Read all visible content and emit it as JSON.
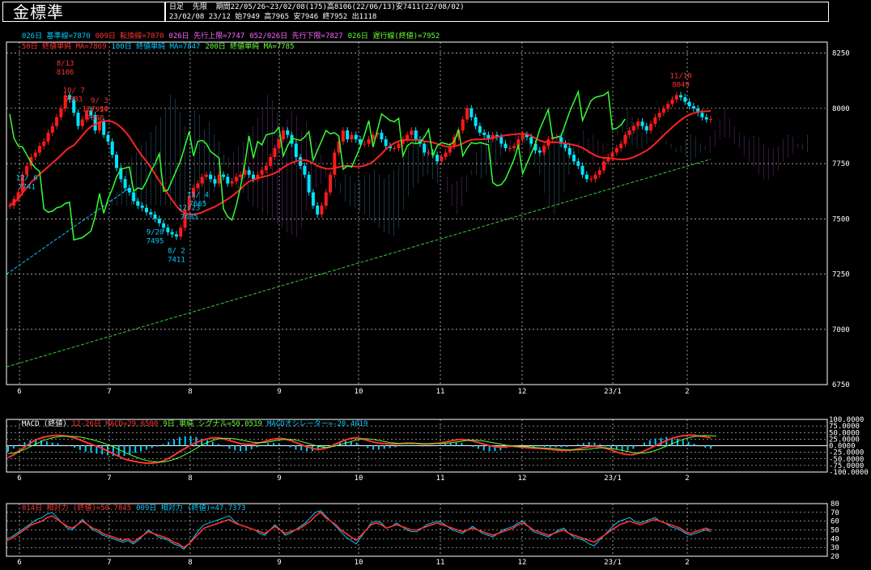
{
  "header": {
    "title": "金標準",
    "line1": "日足  先限  期間22/05/26~23/02/08(175)高8106(22/06/13)安7411(22/08/02)",
    "line2": "23/02/08 23/12 始7949 高7965 安7946 終7952 出1118"
  },
  "legend_main": [
    {
      "text": "026日 基準線=7870",
      "color": "#00ccff"
    },
    {
      "text": "009日 転換線=7870",
      "color": "#ff3333"
    },
    {
      "text": "026日 先行上限=7747",
      "color": "#ff66ff"
    },
    {
      "text": "052/026日 先行下限=7827",
      "color": "#ff66ff"
    },
    {
      "text": "026日 遅行線(終値)=7952",
      "color": "#66ff33"
    },
    {
      "text": "50日 終値単純 MA=7869",
      "color": "#ff3333"
    },
    {
      "text": "100日 終値単純 MA=7847",
      "color": "#00ccff"
    },
    {
      "text": "200日 終値単純 MA=7785",
      "color": "#66ff33"
    }
  ],
  "legend_macd": [
    {
      "text": "MACD (終値)",
      "color": "#ffffff"
    },
    {
      "text": "12-26日 MACD=29.6500",
      "color": "#ff3333"
    },
    {
      "text": "9日 単純 シグナル=50.0519",
      "color": "#66ff33"
    },
    {
      "text": "MACDオシレーター=-20.4019",
      "color": "#00ccff"
    }
  ],
  "legend_rsi": [
    {
      "text": "014日 相対力 (終値)=50.7845",
      "color": "#ff3333"
    },
    {
      "text": "009日 相対力 (終値)=47.7373",
      "color": "#00ccff"
    }
  ],
  "colors": {
    "up": "#ff1a1a",
    "down": "#00e5ff",
    "grid": "#ffffff",
    "kumo_up": "#66ccff",
    "kumo_down": "#cc66ff"
  },
  "x_month_labels": [
    "6",
    "7",
    "8",
    "9",
    "10",
    "11",
    "12",
    "23/1",
    "2"
  ],
  "chart_data": [
    {
      "type": "candlestick",
      "title": "金標準 日足",
      "ylim": [
        6750,
        8300
      ],
      "yticks": [
        6750,
        7000,
        7250,
        7500,
        7750,
        8000,
        8250
      ],
      "grid": true,
      "annotations": [
        {
          "date": "8/13",
          "value": 8106,
          "pos": "high"
        },
        {
          "date": "8/ 2",
          "value": 7411,
          "pos": "low"
        },
        {
          "date": "9/ 3",
          "value": 7937,
          "pos": "high"
        },
        {
          "date": "9/20",
          "value": 7495,
          "pos": "low"
        },
        {
          "date": "10/ 7",
          "value": 7983,
          "pos": "high"
        },
        {
          "date": "11/ 4",
          "value": 7665,
          "pos": "low"
        },
        {
          "date": "11/10",
          "value": 8049,
          "pos": "high"
        },
        {
          "date": "12/ 6",
          "value": 7741,
          "pos": "low"
        },
        {
          "date": "12/ 14",
          "value": 7898,
          "pos": "high"
        },
        {
          "date": "12/23",
          "value": 7605,
          "pos": "low"
        }
      ],
      "close_series": [
        7560,
        7590,
        7620,
        7700,
        7740,
        7780,
        7800,
        7830,
        7850,
        7890,
        7920,
        7960,
        8000,
        8060,
        8040,
        7980,
        7920,
        7950,
        7990,
        7970,
        7900,
        7940,
        7880,
        7850,
        7790,
        7730,
        7680,
        7640,
        7620,
        7580,
        7560,
        7550,
        7530,
        7520,
        7500,
        7480,
        7460,
        7440,
        7430,
        7420,
        7460,
        7540,
        7600,
        7640,
        7660,
        7690,
        7700,
        7680,
        7660,
        7700,
        7690,
        7660,
        7670,
        7690,
        7700,
        7720,
        7700,
        7680,
        7700,
        7720,
        7740,
        7780,
        7820,
        7860,
        7900,
        7880,
        7840,
        7780,
        7740,
        7700,
        7620,
        7560,
        7520,
        7560,
        7620,
        7700,
        7800,
        7850,
        7900,
        7860,
        7880,
        7860,
        7840,
        7840,
        7860,
        7880,
        7890,
        7860,
        7830,
        7820,
        7820,
        7840,
        7860,
        7880,
        7900,
        7860,
        7840,
        7800,
        7800,
        7790,
        7760,
        7780,
        7800,
        7830,
        7870,
        7900,
        7950,
        8000,
        7960,
        7920,
        7890,
        7880,
        7860,
        7880,
        7870,
        7840,
        7820,
        7820,
        7830,
        7860,
        7880,
        7870,
        7840,
        7810,
        7800,
        7830,
        7860,
        7870,
        7870,
        7840,
        7820,
        7790,
        7760,
        7740,
        7700,
        7680,
        7680,
        7700,
        7720,
        7760,
        7780,
        7800,
        7820,
        7840,
        7880,
        7900,
        7920,
        7940,
        7920,
        7900,
        7930,
        7960,
        7980,
        8000,
        8020,
        8040,
        8060,
        8050,
        8030,
        8010,
        8000,
        7980,
        7960,
        7950,
        7952
      ]
    },
    {
      "type": "line",
      "title": "MACD (終値)",
      "ylim": [
        -100,
        100
      ],
      "yticks": [
        "100.0000",
        "75.0000",
        "50.0000",
        "25.0000",
        "0.0000",
        "-25.0000",
        "-50.0000",
        "-75.0000",
        "-100.0000"
      ],
      "series": [
        {
          "name": "12-26日 MACD",
          "color": "#ff3333",
          "values": [
            -45,
            -35,
            -20,
            -5,
            10,
            22,
            30,
            35,
            38,
            40,
            38,
            35,
            30,
            22,
            14,
            6,
            -2,
            -10,
            -20,
            -30,
            -40,
            -50,
            -56,
            -60,
            -64,
            -66,
            -66,
            -64,
            -58,
            -48,
            -36,
            -22,
            -10,
            2,
            12,
            20,
            26,
            30,
            30,
            26,
            20,
            14,
            8,
            5,
            5,
            8,
            14,
            20,
            25,
            28,
            26,
            20,
            12,
            4,
            -4,
            -10,
            -14,
            -12,
            -6,
            4,
            14,
            22,
            28,
            30,
            26,
            20,
            14,
            10,
            8,
            6,
            6,
            8,
            10,
            10,
            8,
            6,
            6,
            8,
            10,
            14,
            18,
            22,
            24,
            22,
            18,
            12,
            6,
            0,
            -4,
            -6,
            -4,
            -2,
            -4,
            -6,
            -8,
            -10,
            -10,
            -12,
            -14,
            -16,
            -18,
            -18,
            -16,
            -12,
            -8,
            -4,
            -2,
            -4,
            -10,
            -16,
            -24,
            -30,
            -34,
            -34,
            -28,
            -20,
            -10,
            0,
            10,
            20,
            28,
            34,
            38,
            40,
            40,
            36,
            34,
            30
          ]
        },
        {
          "name": "9日 単純 シグナル",
          "color": "#66ff33",
          "values": [
            -30,
            -28,
            -22,
            -14,
            -4,
            6,
            16,
            24,
            30,
            34,
            36,
            36,
            35,
            33,
            29,
            24,
            18,
            12,
            4,
            -4,
            -14,
            -24,
            -34,
            -42,
            -50,
            -56,
            -60,
            -62,
            -62,
            -58,
            -52,
            -44,
            -34,
            -22,
            -10,
            2,
            12,
            20,
            26,
            28,
            28,
            26,
            22,
            18,
            14,
            12,
            12,
            14,
            18,
            22,
            24,
            24,
            22,
            16,
            10,
            4,
            -2,
            -6,
            -6,
            -2,
            4,
            10,
            16,
            22,
            26,
            26,
            24,
            20,
            16,
            12,
            10,
            8,
            8,
            8,
            8,
            8,
            8,
            8,
            8,
            9,
            11,
            14,
            17,
            20,
            21,
            20,
            18,
            14,
            10,
            6,
            2,
            0,
            -2,
            -3,
            -4,
            -6,
            -8,
            -9,
            -10,
            -12,
            -14,
            -15,
            -16,
            -16,
            -15,
            -13,
            -10,
            -8,
            -8,
            -10,
            -14,
            -18,
            -22,
            -26,
            -28,
            -28,
            -24,
            -18,
            -10,
            -2,
            8,
            16,
            24,
            30,
            35,
            38,
            39,
            38,
            36
          ]
        }
      ],
      "histogram": {
        "name": "MACDオシレーター",
        "color": "#00ccff"
      }
    },
    {
      "type": "line",
      "title": "相対力",
      "ylim": [
        20,
        80
      ],
      "yticks": [
        80,
        70,
        60,
        50,
        40,
        30,
        20
      ],
      "series": [
        {
          "name": "014日 相対力",
          "color": "#ff3333",
          "values": [
            38,
            40,
            44,
            48,
            52,
            56,
            58,
            60,
            64,
            66,
            62,
            58,
            54,
            52,
            56,
            60,
            56,
            52,
            50,
            46,
            44,
            42,
            40,
            38,
            40,
            36,
            40,
            44,
            48,
            46,
            44,
            42,
            40,
            36,
            34,
            30,
            34,
            40,
            46,
            52,
            54,
            56,
            58,
            60,
            62,
            58,
            56,
            54,
            52,
            50,
            48,
            46,
            50,
            54,
            50,
            46,
            48,
            50,
            52,
            56,
            60,
            66,
            70,
            64,
            60,
            56,
            50,
            46,
            42,
            38,
            44,
            50,
            56,
            58,
            56,
            52,
            54,
            56,
            54,
            52,
            50,
            50,
            52,
            54,
            56,
            58,
            56,
            54,
            52,
            50,
            48,
            50,
            52,
            50,
            48,
            46,
            44,
            46,
            48,
            50,
            52,
            56,
            58,
            54,
            50,
            48,
            46,
            44,
            46,
            48,
            50,
            46,
            44,
            42,
            40,
            38,
            36,
            40,
            44,
            48,
            52,
            56,
            58,
            60,
            58,
            56,
            58,
            60,
            62,
            60,
            58,
            56,
            54,
            52,
            48,
            46,
            48,
            50,
            52,
            50
          ]
        },
        {
          "name": "009日 相対力",
          "color": "#00ccff",
          "values": [
            40,
            42,
            46,
            50,
            54,
            58,
            62,
            64,
            68,
            70,
            64,
            58,
            52,
            50,
            56,
            62,
            56,
            50,
            48,
            44,
            42,
            40,
            38,
            36,
            38,
            34,
            38,
            44,
            50,
            46,
            42,
            40,
            38,
            34,
            32,
            28,
            34,
            42,
            50,
            56,
            58,
            60,
            62,
            64,
            66,
            60,
            56,
            54,
            52,
            50,
            46,
            44,
            50,
            56,
            50,
            44,
            46,
            50,
            54,
            58,
            64,
            70,
            72,
            66,
            60,
            54,
            48,
            42,
            38,
            34,
            42,
            50,
            58,
            60,
            58,
            52,
            54,
            58,
            54,
            50,
            48,
            48,
            52,
            56,
            58,
            60,
            58,
            54,
            50,
            48,
            46,
            50,
            54,
            50,
            46,
            44,
            42,
            46,
            50,
            52,
            54,
            58,
            60,
            54,
            48,
            46,
            44,
            42,
            46,
            50,
            52,
            46,
            42,
            40,
            38,
            34,
            32,
            38,
            44,
            50,
            56,
            60,
            62,
            64,
            60,
            58,
            60,
            62,
            64,
            60,
            58,
            54,
            52,
            50,
            46,
            44,
            46,
            48,
            50,
            48
          ]
        }
      ]
    }
  ]
}
